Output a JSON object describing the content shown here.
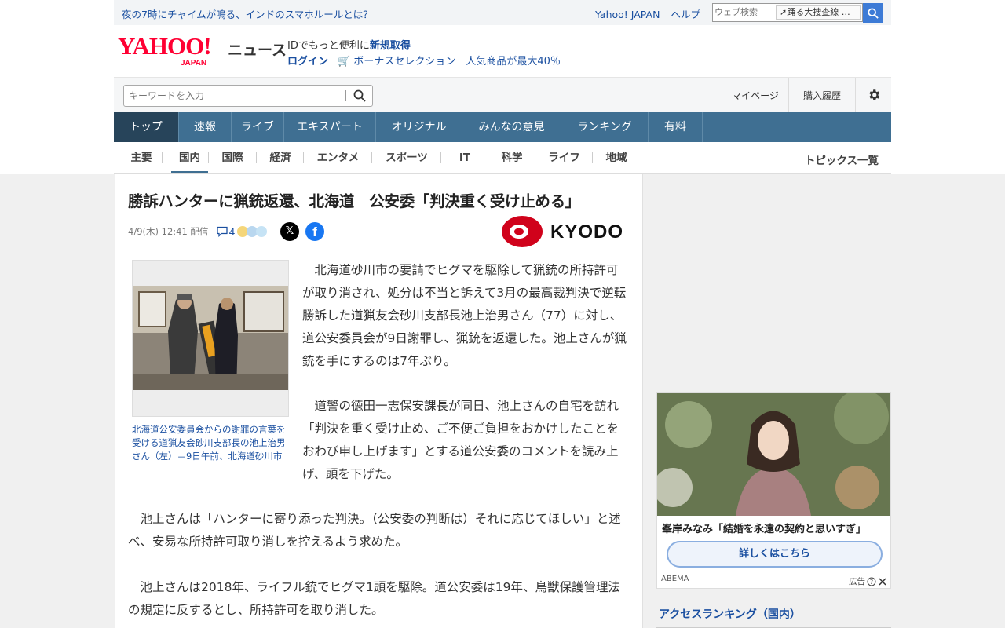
{
  "topbar": {
    "notice": "夜の7時にチャイムが鳴る、インドのスマホルールとは？",
    "yahoo_japan": "Yahoo! JAPAN",
    "help": "ヘルプ",
    "web_search_placeholder": "ウェブ検索",
    "trend_label": "踊る大捜査線 …"
  },
  "logo": {
    "yahoo": "YAHOO!",
    "japan": "JAPAN",
    "news": "ニュース"
  },
  "account": {
    "id_prefix": "IDでもっと便利に",
    "id_link": "新規取得",
    "login": "ログイン",
    "promo": "ボーナスセレクション　人気商品が最大40％"
  },
  "search": {
    "placeholder": "キーワードを入力",
    "mypage": "マイページ",
    "history": "購入履歴"
  },
  "nav": {
    "items": [
      "トップ",
      "速報",
      "ライブ",
      "エキスパート",
      "オリジナル",
      "みんなの意見",
      "ランキング",
      "有料"
    ]
  },
  "subnav": {
    "items": [
      "主要",
      "国内",
      "国際",
      "経済",
      "エンタメ",
      "スポーツ",
      "IT",
      "科学",
      "ライフ",
      "地域"
    ],
    "topics": "トピックス一覧"
  },
  "article": {
    "title": "勝訴ハンターに猟銃返還、北海道　公安委「判決重く受け止める」",
    "date": "4/9(木) 12:41 配信",
    "comment_count": "4",
    "publisher": "KYODO",
    "caption": "北海道公安委員会からの謝罪の言葉を受ける道猟友会砂川支部長の池上治男さん（左）＝9日午前、北海道砂川市",
    "p1": "北海道砂川市の要請でヒグマを駆除して猟銃の所持許可が取り消され、処分は不当と訴えて3月の最高裁判決で逆転勝訴した道猟友会砂川支部長池上治男さん（77）に対し、道公安委員会が9日謝罪し、猟銃を返還した。池上さんが猟銃を手にするのは7年ぶり。",
    "p2": "道警の徳田一志保安課長が同日、池上さんの自宅を訪れ「判決を重く受け止め、ご不便ご負担をおかけしたことをおわび申し上げます」とする道公安委のコメントを読み上げ、頭を下げた。",
    "p3": "池上さんは「ハンターに寄り添った判決。（公安委の判断は）それに応じてほしい」と述べ、安易な所持許可取り消しを控えるよう求めた。",
    "p4": "池上さんは2018年、ライフル銃でヒグマ1頭を駆除。道公安委は19年、鳥獣保護管理法の規定に反するとし、所持許可を取り消した。"
  },
  "ad": {
    "title": "峯岸みなみ「結婚を永遠の契約と思いすぎ」",
    "button": "詳しくはこちら",
    "source": "ABEMA",
    "label": "広告"
  },
  "ranking": {
    "title": "アクセスランキング（国内）"
  },
  "colors": {
    "nav_bg": "#3f6f92",
    "nav_active": "#27445a",
    "link_blue": "#1a4fa0",
    "yahoo_red": "#ff0033",
    "kyodo_red": "#d0021b"
  }
}
